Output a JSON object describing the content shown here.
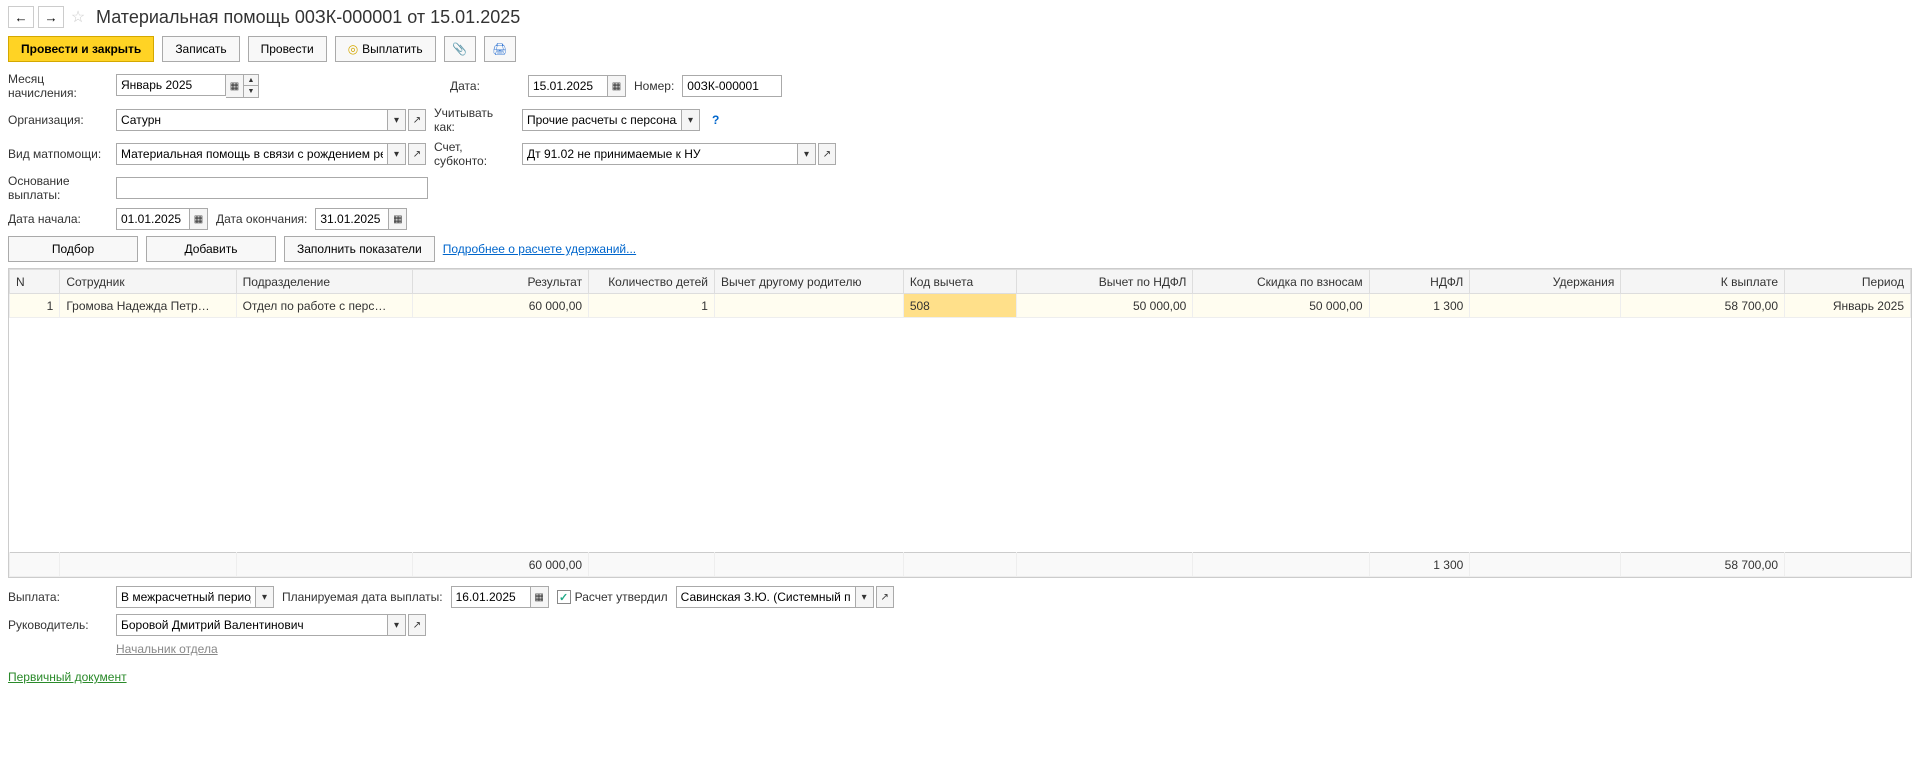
{
  "header": {
    "title": "Материальная помощь 00ЗК-000001 от 15.01.2025"
  },
  "toolbar": {
    "post_close": "Провести и закрыть",
    "save": "Записать",
    "post": "Провести",
    "pay": "Выплатить"
  },
  "form": {
    "month_label": "Месяц начисления:",
    "month_value": "Январь 2025",
    "date_label": "Дата:",
    "date_value": "15.01.2025",
    "number_label": "Номер:",
    "number_value": "00ЗК-000001",
    "org_label": "Организация:",
    "org_value": "Сатурн",
    "account_as_label": "Учитывать как:",
    "account_as_value": "Прочие расчеты с персоналом",
    "type_label": "Вид матпомощи:",
    "type_value": "Материальная помощь в связи с рождением ребенка",
    "account_label": "Счет, субконто:",
    "account_value": "Дт 91.02 не принимаемые к НУ",
    "reason_label": "Основание выплаты:",
    "reason_value": "",
    "start_label": "Дата начала:",
    "start_value": "01.01.2025",
    "end_label": "Дата окончания:",
    "end_value": "31.01.2025"
  },
  "sub_toolbar": {
    "pick": "Подбор",
    "add": "Добавить",
    "fill": "Заполнить показатели",
    "details_link": "Подробнее о расчете удержаний..."
  },
  "table": {
    "headers": {
      "n": "N",
      "employee": "Сотрудник",
      "dept": "Подразделение",
      "result": "Результат",
      "children": "Количество детей",
      "deduct_other": "Вычет другому родителю",
      "deduct_code": "Код вычета",
      "deduct_ndfl": "Вычет по НДФЛ",
      "discount": "Скидка по взносам",
      "ndfl": "НДФЛ",
      "withhold": "Удержания",
      "to_pay": "К выплате",
      "period": "Период"
    },
    "rows": [
      {
        "n": "1",
        "employee": "Громова Надежда Петр…",
        "dept": "Отдел по работе с перс…",
        "result": "60 000,00",
        "children": "1",
        "deduct_other": "",
        "deduct_code": "508",
        "deduct_ndfl": "50 000,00",
        "discount": "50 000,00",
        "ndfl": "1 300",
        "withhold": "",
        "to_pay": "58 700,00",
        "period": "Январь 2025"
      }
    ],
    "footer": {
      "result": "60 000,00",
      "ndfl": "1 300",
      "to_pay": "58 700,00"
    }
  },
  "footer_form": {
    "payout_label": "Выплата:",
    "payout_value": "В межрасчетный период",
    "planned_label": "Планируемая дата выплаты:",
    "planned_value": "16.01.2025",
    "approved_label": "Расчет утвердил",
    "approver_value": "Савинская З.Ю. (Системный про",
    "manager_label": "Руководитель:",
    "manager_value": "Боровой Дмитрий Валентинович",
    "manager_title": "Начальник отдела"
  },
  "footer_link": "Первичный документ"
}
